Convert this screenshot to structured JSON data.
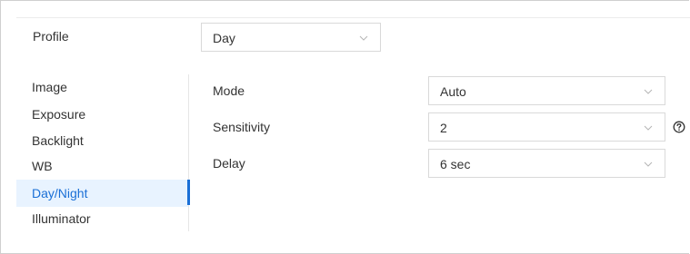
{
  "profile": {
    "label": "Profile",
    "value": "Day"
  },
  "sidebar": {
    "items": [
      {
        "label": "Image"
      },
      {
        "label": "Exposure"
      },
      {
        "label": "Backlight"
      },
      {
        "label": "WB"
      },
      {
        "label": "Day/Night"
      },
      {
        "label": "Illuminator"
      }
    ],
    "active": "Day/Night"
  },
  "settings": {
    "mode": {
      "label": "Mode",
      "value": "Auto"
    },
    "sensitivity": {
      "label": "Sensitivity",
      "value": "2",
      "help_icon": "question-circle-icon"
    },
    "delay": {
      "label": "Delay",
      "value": "6 sec"
    }
  },
  "colors": {
    "accent": "#1a6fd6",
    "active_bg": "#e8f3ff",
    "border": "#d9d9d9"
  }
}
